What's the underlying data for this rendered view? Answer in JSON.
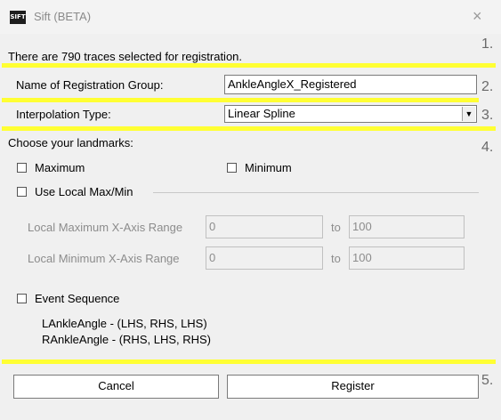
{
  "window": {
    "title": "Sift (BETA)",
    "icon_label": "SIFT",
    "close_symbol": "×"
  },
  "header": {
    "message": "There are 790 traces selected for registration."
  },
  "group": {
    "label": "Name of Registration Group:",
    "value": "AnkleAngleX_Registered"
  },
  "interpolation": {
    "label": "Interpolation Type:",
    "selected": "Linear Spline",
    "arrow": "▼"
  },
  "landmarks": {
    "heading": "Choose your landmarks:",
    "maximum_label": "Maximum",
    "minimum_label": "Minimum",
    "use_local_label": "Use Local Max/Min",
    "local_max_label": "Local Maximum X-Axis Range",
    "local_max_from": "0",
    "local_max_to": "100",
    "local_min_label": "Local Minimum X-Axis Range",
    "local_min_from": "0",
    "local_min_to": "100",
    "to_label": "to",
    "event_sequence_label": "Event Sequence",
    "sequences": [
      "LAnkleAngle - (LHS, RHS, LHS)",
      "RAnkleAngle - (RHS, LHS, RHS)"
    ]
  },
  "buttons": {
    "cancel": "Cancel",
    "register": "Register"
  },
  "annotations": {
    "n1": "1.",
    "n2": "2.",
    "n3": "3.",
    "n4": "4.",
    "n5": "5.",
    "highlight_color": "#ffff33"
  }
}
